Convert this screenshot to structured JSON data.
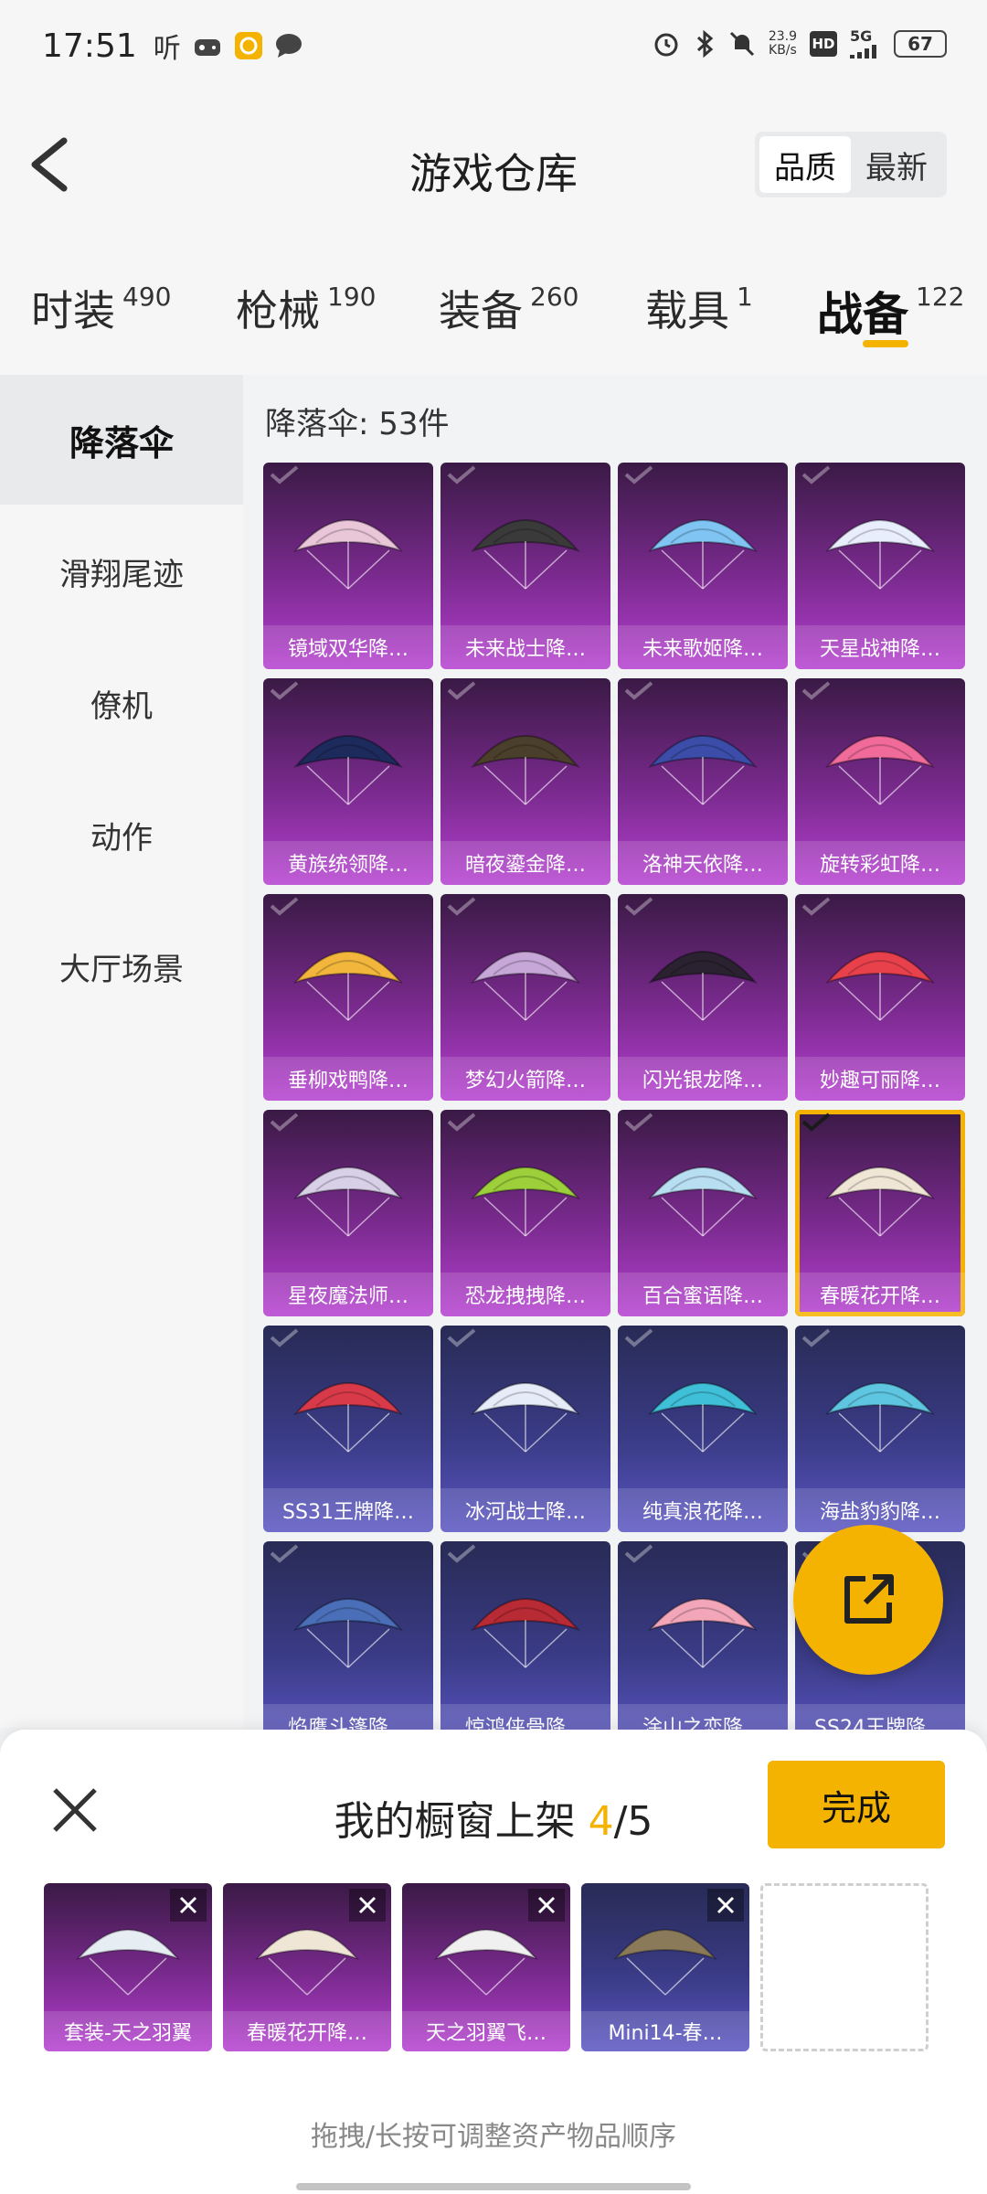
{
  "status_bar": {
    "time": "17:51",
    "app_icon_text": "听",
    "net_speed_value": "23.9",
    "net_speed_unit": "KB/s",
    "hd_label": "HD",
    "network": "5G",
    "battery": "67",
    "icons": [
      "game-icon",
      "app-orange-icon",
      "message-icon",
      "alarm-icon",
      "bluetooth-icon",
      "mute-icon",
      "signal-icon"
    ]
  },
  "header": {
    "title": "游戏仓库",
    "sort_options": [
      "品质",
      "最新"
    ],
    "sort_active": "品质"
  },
  "tabs": [
    {
      "label": "时装",
      "count": "490"
    },
    {
      "label": "枪械",
      "count": "190"
    },
    {
      "label": "装备",
      "count": "260"
    },
    {
      "label": "载具",
      "count": "1"
    },
    {
      "label": "战备",
      "count": "122"
    }
  ],
  "active_tab": "战备",
  "sidebar": {
    "items": [
      "降落伞",
      "滑翔尾迹",
      "僚机",
      "动作",
      "大厅场景"
    ],
    "active": "降落伞"
  },
  "main": {
    "count_label": "降落伞: 53件",
    "items": [
      {
        "name": "镜域双华降…",
        "color": "purple",
        "art": "#e9c6d8",
        "owned": true,
        "selected": false
      },
      {
        "name": "未来战士降…",
        "color": "purple",
        "art": "#3a3a3a",
        "owned": true,
        "selected": false
      },
      {
        "name": "未来歌姬降…",
        "color": "purple",
        "art": "#7fc4f2",
        "owned": true,
        "selected": false
      },
      {
        "name": "天星战神降…",
        "color": "purple",
        "art": "#e8eefc",
        "owned": true,
        "selected": false
      },
      {
        "name": "黄族统领降…",
        "color": "purple",
        "art": "#1d2a5c",
        "owned": true,
        "selected": false
      },
      {
        "name": "暗夜鎏金降…",
        "color": "purple",
        "art": "#4a3f2a",
        "owned": true,
        "selected": false
      },
      {
        "name": "洛神天依降…",
        "color": "purple",
        "art": "#3b4da8",
        "owned": true,
        "selected": false
      },
      {
        "name": "旋转彩虹降…",
        "color": "purple",
        "art": "#f06a9a",
        "owned": true,
        "selected": false
      },
      {
        "name": "垂柳戏鸭降…",
        "color": "purple",
        "art": "#f2b63c",
        "owned": true,
        "selected": false
      },
      {
        "name": "梦幻火箭降…",
        "color": "purple",
        "art": "#c7a6d8",
        "owned": true,
        "selected": false
      },
      {
        "name": "闪光银龙降…",
        "color": "purple",
        "art": "#2a2230",
        "owned": true,
        "selected": false
      },
      {
        "name": "妙趣可丽降…",
        "color": "purple",
        "art": "#e8414c",
        "owned": true,
        "selected": false
      },
      {
        "name": "星夜魔法师…",
        "color": "purple",
        "art": "#d8d0e6",
        "owned": true,
        "selected": false
      },
      {
        "name": "恐龙拽拽降…",
        "color": "purple",
        "art": "#9ccf3a",
        "owned": true,
        "selected": false
      },
      {
        "name": "百合蜜语降…",
        "color": "purple",
        "art": "#b8def2",
        "owned": true,
        "selected": false
      },
      {
        "name": "春暖花开降…",
        "color": "purple",
        "art": "#efe6d6",
        "owned": true,
        "selected": true
      },
      {
        "name": "SS31王牌降…",
        "color": "blue",
        "art": "#d93a4a",
        "owned": true,
        "selected": false
      },
      {
        "name": "冰河战士降…",
        "color": "blue",
        "art": "#e6ecf8",
        "owned": true,
        "selected": false
      },
      {
        "name": "纯真浪花降…",
        "color": "blue",
        "art": "#3fc0d8",
        "owned": true,
        "selected": false
      },
      {
        "name": "海盐豹豹降…",
        "color": "blue",
        "art": "#5fc6e2",
        "owned": true,
        "selected": false
      },
      {
        "name": "焰鹰斗篷降…",
        "color": "blue",
        "art": "#4a6fb8",
        "owned": true,
        "selected": false
      },
      {
        "name": "惊鸿侠骨降…",
        "color": "blue",
        "art": "#b82a34",
        "owned": true,
        "selected": false
      },
      {
        "name": "涂山之恋降…",
        "color": "blue",
        "art": "#f2a6b8",
        "owned": true,
        "selected": false
      },
      {
        "name": "SS24王牌降…",
        "color": "blue",
        "art": "#3a3f7a",
        "owned": true,
        "selected": false
      }
    ]
  },
  "showcase": {
    "title_prefix": "我的橱窗上架 ",
    "current": "4",
    "total": "/5",
    "done_label": "完成",
    "slots": [
      {
        "name": "套装-天之羽翼",
        "color": "purple",
        "art": "#e6eef4"
      },
      {
        "name": "春暖花开降…",
        "color": "purple",
        "art": "#efe6d6"
      },
      {
        "name": "天之羽翼飞…",
        "color": "purple",
        "art": "#f0f0f0"
      },
      {
        "name": "Mini14-春…",
        "color": "blue",
        "art": "#8a7a5a"
      }
    ],
    "hint": "拖拽/长按可调整资产物品顺序"
  },
  "colors": {
    "accent": "#f5b301",
    "purple_rarity": "#b53fd0",
    "blue_rarity": "#5a55c2"
  }
}
